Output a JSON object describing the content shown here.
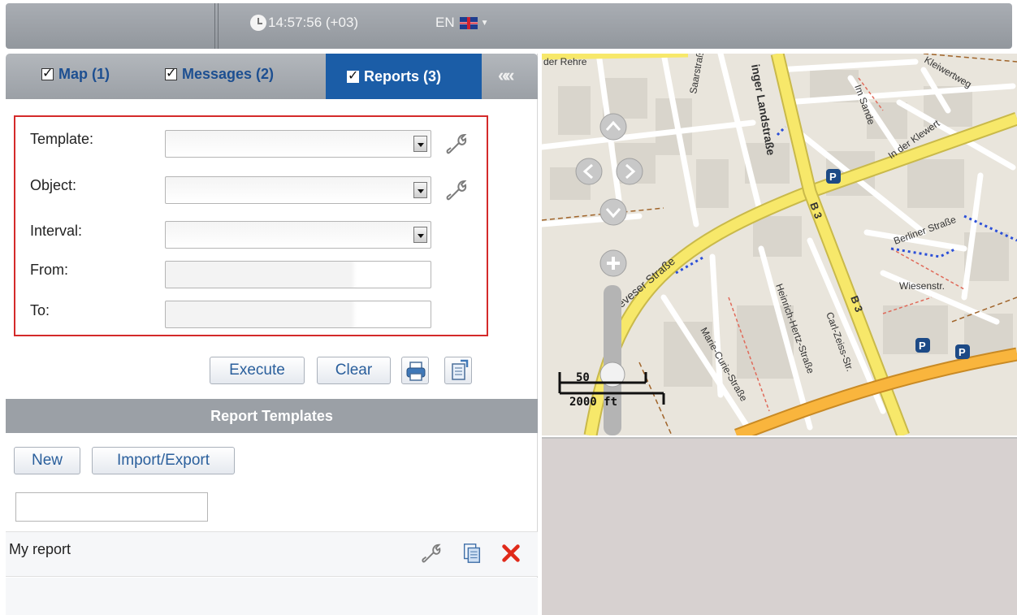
{
  "header": {
    "clock_text": "14:57:56 (+03)",
    "language": "EN",
    "icons": {
      "clock": "clock-icon",
      "flag": "uk-flag-icon",
      "caret": "chevron-down-icon"
    }
  },
  "tabs": [
    {
      "label": "Map (1)",
      "checked": true,
      "active": false
    },
    {
      "label": "Messages (2)",
      "checked": true,
      "active": false
    },
    {
      "label": "Reports (3)",
      "checked": true,
      "active": true
    }
  ],
  "collapse_label": "«",
  "report_form": {
    "template_label": "Template:",
    "object_label": "Object:",
    "interval_label": "Interval:",
    "from_label": "From:",
    "to_label": "To:",
    "template_value": "",
    "object_value": "",
    "interval_value": "",
    "from_value": "",
    "to_value": ""
  },
  "actions": {
    "execute_label": "Execute",
    "clear_label": "Clear",
    "icons": {
      "print": "printer-icon",
      "export": "export-icon"
    }
  },
  "templates_section": {
    "header": "Report Templates",
    "new_label": "New",
    "import_export_label": "Import/Export",
    "filter_value": "",
    "items": [
      {
        "name": "My report"
      }
    ],
    "item_icons": {
      "edit": "wrench-icon",
      "copy": "copy-icon",
      "delete": "delete-x-icon"
    }
  },
  "map": {
    "street_labels": [
      "der Rehre",
      "inger Landstraße",
      "Deveser Straße",
      "B 3",
      "B 3",
      "Heinrich-Hertz-Straße",
      "Carl-Zeiss-Str.",
      "Marie-Curie-Straße",
      "Berliner Straße",
      "In der Klewert",
      "Im Sande",
      "Saarstraße",
      "Kleiwertweg",
      "Wiesenstr."
    ],
    "scale_top": "50",
    "scale_bottom": "2000 ft",
    "colors": {
      "primary_road": "#f7e86a",
      "main_road": "#f9b53d",
      "minor_road": "#ffffff",
      "block": "#d9d5cc",
      "background": "#e9e5dc",
      "parking": "#1d4a86"
    }
  },
  "colors": {
    "active_tab": "#1b5da7",
    "highlight_border": "#d42a2a",
    "link_text": "#2a5f9c"
  }
}
